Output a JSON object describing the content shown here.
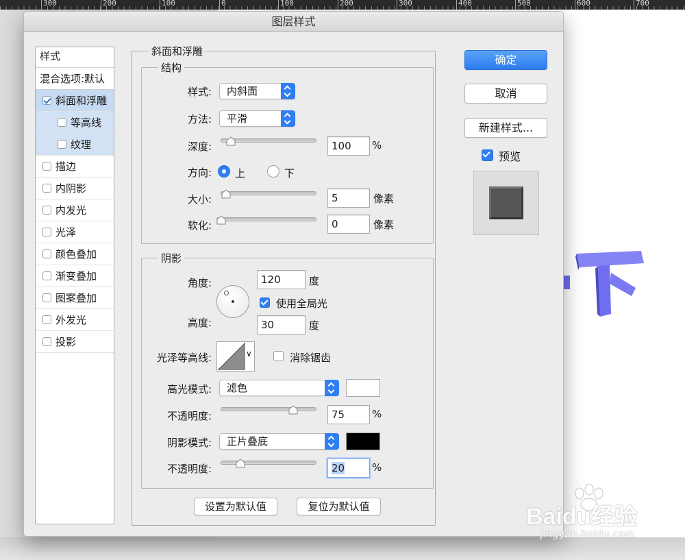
{
  "ruler": {
    "labels": [
      "300",
      "200",
      "100",
      "0",
      "100",
      "200",
      "300",
      "400",
      "500",
      "600",
      "700"
    ]
  },
  "dialog": {
    "title": "图层样式"
  },
  "style_list": {
    "header": "样式",
    "blend_options": "混合选项:默认",
    "items": [
      {
        "label": "斜面和浮雕",
        "checked": true
      },
      {
        "label": "等高线",
        "checked": false
      },
      {
        "label": "纹理",
        "checked": false
      },
      {
        "label": "描边",
        "checked": false
      },
      {
        "label": "内阴影",
        "checked": false
      },
      {
        "label": "内发光",
        "checked": false
      },
      {
        "label": "光泽",
        "checked": false
      },
      {
        "label": "颜色叠加",
        "checked": false
      },
      {
        "label": "渐变叠加",
        "checked": false
      },
      {
        "label": "图案叠加",
        "checked": false
      },
      {
        "label": "外发光",
        "checked": false
      },
      {
        "label": "投影",
        "checked": false
      }
    ]
  },
  "bevel": {
    "title": "斜面和浮雕",
    "structure": {
      "title": "结构",
      "style_label": "样式:",
      "style_value": "内斜面",
      "technique_label": "方法:",
      "technique_value": "平滑",
      "depth_label": "深度:",
      "depth_value": "100",
      "depth_unit": "%",
      "direction_label": "方向:",
      "direction_up": "上",
      "direction_down": "下",
      "size_label": "大小:",
      "size_value": "5",
      "size_unit": "像素",
      "soften_label": "软化:",
      "soften_value": "0",
      "soften_unit": "像素"
    },
    "shading": {
      "title": "阴影",
      "angle_label": "角度:",
      "angle_value": "120",
      "angle_unit": "度",
      "global_light_label": "使用全局光",
      "altitude_label": "高度:",
      "altitude_value": "30",
      "altitude_unit": "度",
      "gloss_label": "光泽等高线:",
      "antialias_label": "消除锯齿",
      "highlight_mode_label": "高光模式:",
      "highlight_mode_value": "滤色",
      "highlight_color": "#ffffff",
      "highlight_opacity_label": "不透明度:",
      "highlight_opacity_value": "75",
      "highlight_opacity_unit": "%",
      "shadow_mode_label": "阴影模式:",
      "shadow_mode_value": "正片叠底",
      "shadow_color": "#000000",
      "shadow_opacity_label": "不透明度:",
      "shadow_opacity_value": "20",
      "shadow_opacity_unit": "%"
    },
    "make_default": "设置为默认值",
    "reset_default": "复位为默认值"
  },
  "buttons": {
    "ok": "确定",
    "cancel": "取消",
    "new_style": "新建样式...",
    "preview": "预览"
  },
  "watermark": {
    "brand": "Baidu经验",
    "url": "jingyan.baidu.com"
  },
  "colors": {
    "accent": "#2f7ef2",
    "art": "#6f6ef0"
  }
}
